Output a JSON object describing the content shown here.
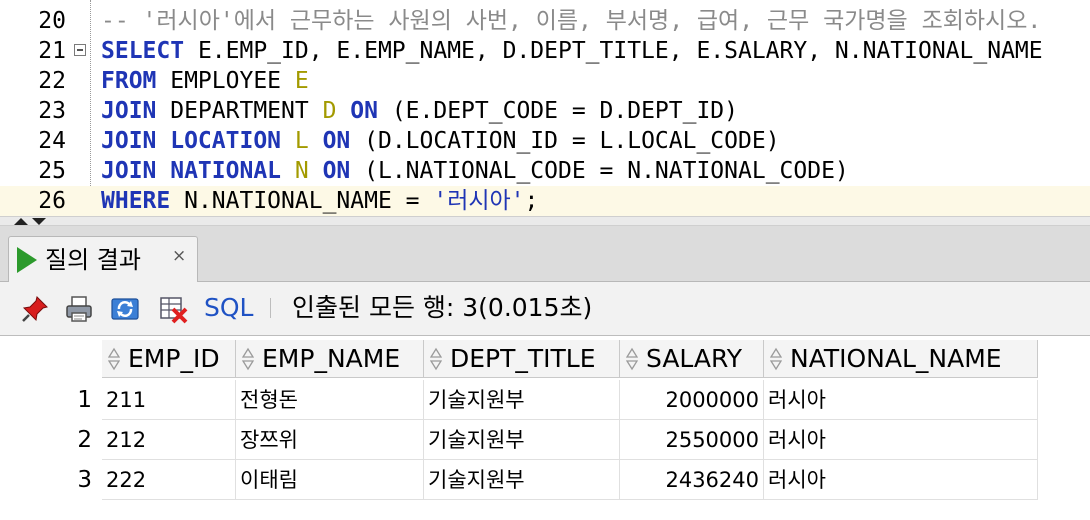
{
  "editor": {
    "lines": [
      {
        "num": "20",
        "text": "-- '러시아'에서 근무하는 사원의 사번, 이름, 부서명, 급여, 근무 국가명을 조회하시오."
      },
      {
        "num": "21",
        "kw": "SELECT",
        "text": " E.EMP_ID, E.EMP_NAME, D.DEPT_TITLE, E.SALARY, N.NATIONAL_NAME"
      },
      {
        "num": "22",
        "kw": "FROM",
        "text": " EMPLOYEE ",
        "alias": "E"
      },
      {
        "num": "23",
        "kw": "JOIN",
        "text": " DEPARTMENT ",
        "alias": "D",
        "kw2": " ON",
        "text2": " (E.DEPT_CODE = D.DEPT_ID)"
      },
      {
        "num": "24",
        "kw": "JOIN",
        "kwb": " LOCATION ",
        "alias": "L",
        "kw2": " ON",
        "text2": " (D.LOCATION_ID = L.LOCAL_CODE)"
      },
      {
        "num": "25",
        "kw": "JOIN",
        "kwb": " NATIONAL ",
        "alias": "N",
        "kw2": " ON",
        "text2": " (L.NATIONAL_CODE = N.NATIONAL_CODE)"
      },
      {
        "num": "26",
        "kw": "WHERE",
        "text": " N.NATIONAL_NAME = ",
        "str": "'러시아'",
        "text2": ";"
      }
    ]
  },
  "results_tab": {
    "label": "질의 결과",
    "close": "×"
  },
  "toolbar": {
    "sql_label": "SQL",
    "status": "인출된 모든 행: 3(0.015초)"
  },
  "grid": {
    "columns": [
      "EMP_ID",
      "EMP_NAME",
      "DEPT_TITLE",
      "SALARY",
      "NATIONAL_NAME"
    ],
    "rows": [
      {
        "num": "1",
        "cells": [
          "211",
          "전형돈",
          "기술지원부",
          "2000000",
          "러시아"
        ]
      },
      {
        "num": "2",
        "cells": [
          "212",
          "장쯔위",
          "기술지원부",
          "2550000",
          "러시아"
        ]
      },
      {
        "num": "3",
        "cells": [
          "222",
          "이태림",
          "기술지원부",
          "2436240",
          "러시아"
        ]
      }
    ]
  },
  "colors": {
    "keyword": "#1f35b5",
    "alias": "#a39a00",
    "comment": "#8a8a8a",
    "current_line": "#fdf9e6",
    "run_icon": "#2c9a2c",
    "sql_link": "#1f52c4"
  },
  "icons": [
    "pin-icon",
    "print-icon",
    "refresh-icon",
    "export-icon",
    "run-icon",
    "sort-icon"
  ]
}
